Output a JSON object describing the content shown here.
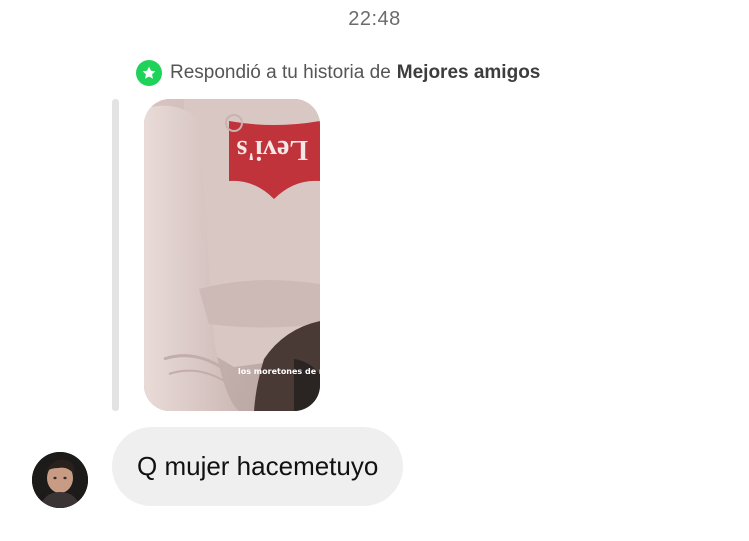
{
  "timestamp": "22:48",
  "story_reply": {
    "prefix": "Respondió a tu historia de",
    "list_name": "Mejores amigos",
    "badge_icon": "star-icon",
    "badge_color": "#1fd35a",
    "sticker_text": "los moretones de mi piernas son gol..."
  },
  "message": {
    "text": "Q mujer hacemetuyo",
    "bubble_color": "#efefef"
  },
  "sender": {
    "avatar_icon": "profile-photo"
  }
}
